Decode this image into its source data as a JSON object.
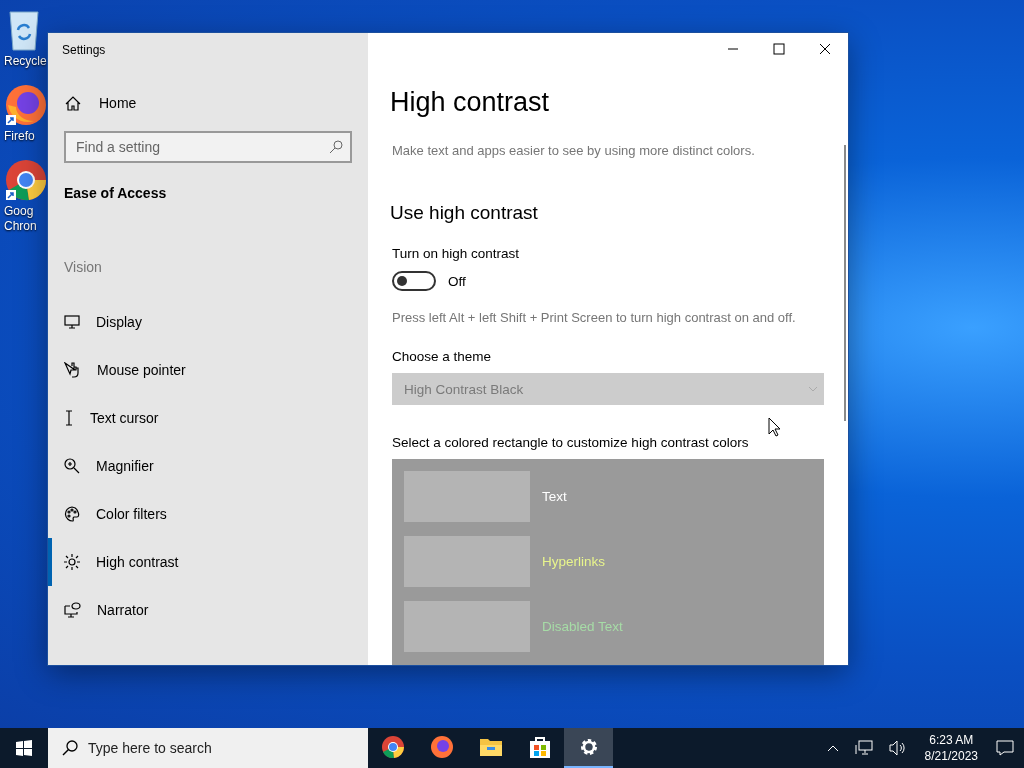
{
  "desktop_icons": [
    {
      "label": "Recycle",
      "kind": "recycle"
    },
    {
      "label": "Firefo",
      "kind": "firefox"
    },
    {
      "label": "Goog\nChron",
      "kind": "chrome"
    }
  ],
  "window": {
    "title": "Settings"
  },
  "sidebar": {
    "home": "Home",
    "search": {
      "placeholder": "Find a setting"
    },
    "category": "Ease of Access",
    "group": "Vision",
    "items": [
      {
        "label": "Display",
        "selected": false
      },
      {
        "label": "Mouse pointer",
        "selected": false
      },
      {
        "label": "Text cursor",
        "selected": false
      },
      {
        "label": "Magnifier",
        "selected": false
      },
      {
        "label": "Color filters",
        "selected": false
      },
      {
        "label": "High contrast",
        "selected": true
      },
      {
        "label": "Narrator",
        "selected": false
      }
    ]
  },
  "content": {
    "title": "High contrast",
    "description": "Make text and apps easier to see by using more distinct colors.",
    "section": "Use high contrast",
    "toggle_label": "Turn on high contrast",
    "toggle": {
      "on": false,
      "state_text": "Off"
    },
    "hint": "Press left Alt + left Shift + Print Screen to turn high contrast on and off.",
    "theme_label": "Choose a theme",
    "theme": {
      "value": "High Contrast Black",
      "disabled": true
    },
    "colors_label": "Select a colored rectangle to customize high contrast colors",
    "color_rows": [
      {
        "label": "Text",
        "color": "#ffffff"
      },
      {
        "label": "Hyperlinks",
        "color": "#e8f58c"
      },
      {
        "label": "Disabled Text",
        "color": "#a6dca6"
      }
    ]
  },
  "taskbar": {
    "search": {
      "placeholder": "Type here to search"
    },
    "apps": [
      {
        "kind": "chrome",
        "selected": false
      },
      {
        "kind": "firefox",
        "selected": false
      },
      {
        "kind": "folder",
        "selected": false
      },
      {
        "kind": "store",
        "selected": false
      },
      {
        "kind": "gear",
        "selected": true
      }
    ],
    "time": "6:23 AM",
    "date": "8/21/2023"
  }
}
